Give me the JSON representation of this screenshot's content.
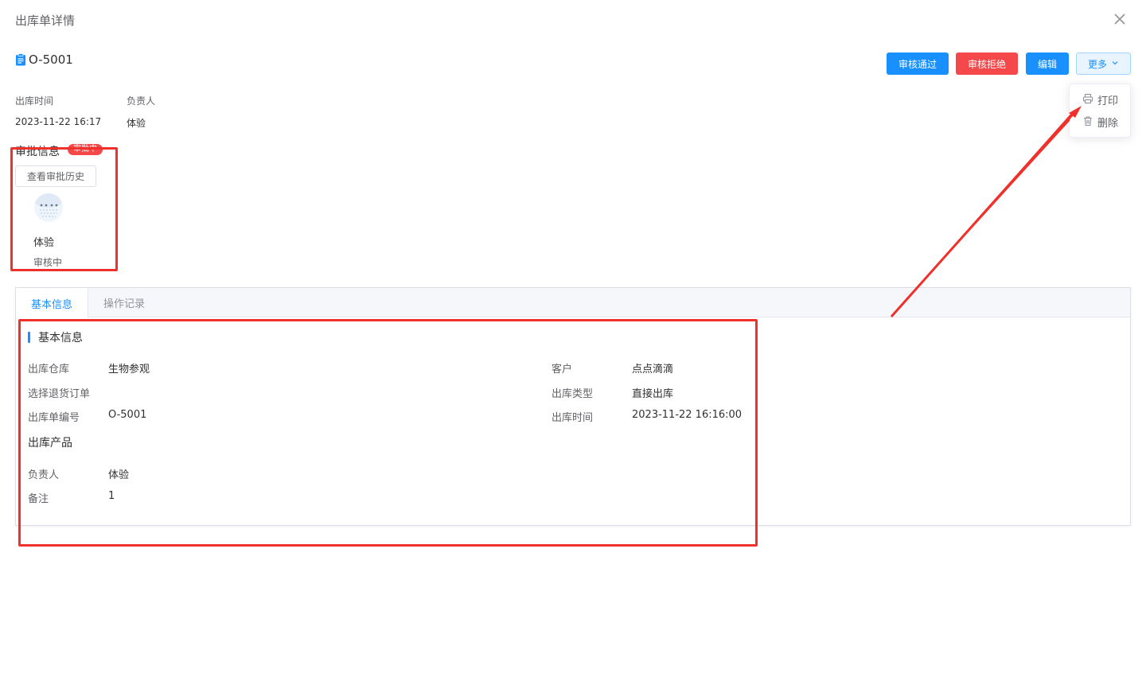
{
  "dialog": {
    "title": "出库单详情"
  },
  "document": {
    "number": "O-5001"
  },
  "actions": {
    "approve": "审核通过",
    "reject": "审核拒绝",
    "edit": "编辑",
    "more": "更多"
  },
  "more_menu": {
    "print": "打印",
    "delete": "删除"
  },
  "meta": [
    {
      "label": "出库时间",
      "value": "2023-11-22 16:17"
    },
    {
      "label": "负责人",
      "value": "体验"
    }
  ],
  "approval": {
    "title": "审批信息",
    "badge": "审批中",
    "history_button": "查看审批历史",
    "approver_name": "体验",
    "approver_status": "审核中"
  },
  "tabs": [
    {
      "label": "基本信息",
      "active": true
    },
    {
      "label": "操作记录",
      "active": false
    }
  ],
  "basic_info": {
    "section_title": "基本信息",
    "left_fields": [
      {
        "label": "出库仓库",
        "value": "生物参观"
      },
      {
        "label": "选择退货订单",
        "value": ""
      },
      {
        "label": "出库单编号",
        "value": "O-5001"
      }
    ],
    "right_fields": [
      {
        "label": "客户",
        "value": "点点滴滴"
      },
      {
        "label": "出库类型",
        "value": "直接出库"
      },
      {
        "label": "出库时间",
        "value": "2023-11-22 16:16:00"
      }
    ],
    "product_section_title": "出库产品",
    "bottom_fields": [
      {
        "label": "负责人",
        "value": "体验"
      },
      {
        "label": "备注",
        "value": "1"
      }
    ]
  },
  "colors": {
    "primary": "#1890ff",
    "danger": "#f5484a",
    "annotation": "#f0302a"
  }
}
